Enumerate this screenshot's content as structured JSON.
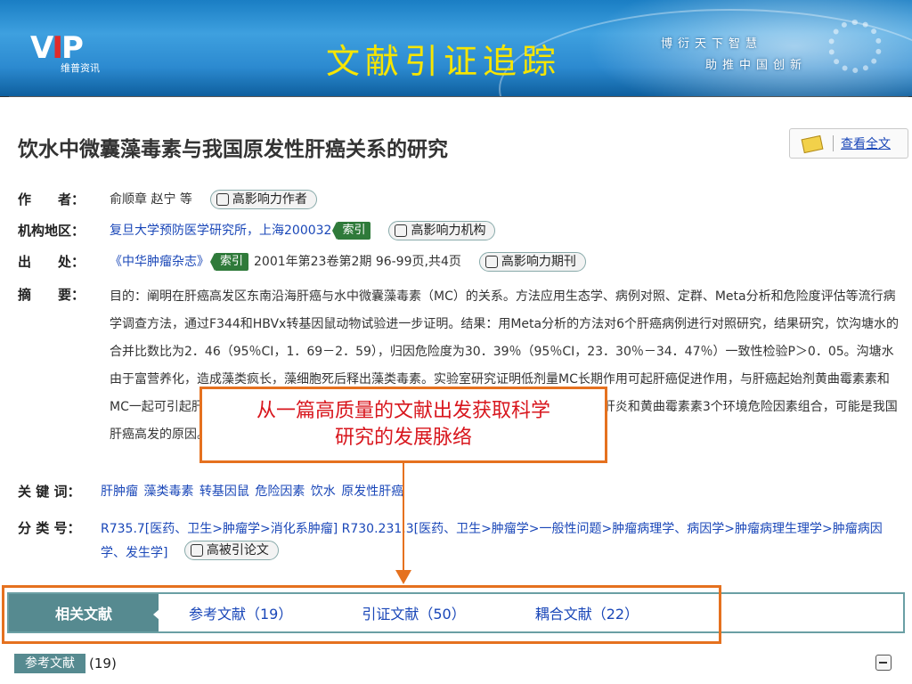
{
  "banner": {
    "logo_text": "VIP",
    "logo_sub": "维普资讯",
    "title": "文献引证追踪",
    "slogan_line1": "博衍天下智慧",
    "slogan_line2": "助推中国创新"
  },
  "article": {
    "title": "饮水中微囊藻毒素与我国原发性肝癌关系的研究",
    "fulltext_label": "查看全文",
    "author_label": "作　　者：",
    "authors": "俞顺章 赵宁 等",
    "author_pill": "高影响力作者",
    "org_label": "机构地区：",
    "org": "复旦大学预防医学研究所，上海200032",
    "org_index": "索引",
    "org_pill": "高影响力机构",
    "source_label": "出　　处：",
    "source_journal": "《中华肿瘤杂志》",
    "source_index": "索引",
    "source_detail": "2001年第23卷第2期 96-99页,共4页",
    "source_pill": "高影响力期刊",
    "abstract_label": "摘　　要：",
    "abstract": "目的：阐明在肝癌高发区东南沿海肝癌与水中微囊藻毒素（MC）的关系。方法应用生态学、病例对照、定群、Meta分析和危险度评估等流行病学调查方法，通过F344和HBVx转基因鼠动物试验进一步证明。结果：用Meta分析的方法对6个肝癌病例进行对照研究，结果研究，饮沟塘水的合并比数比为2．46（95％CI，1．69－2．59），归因危险度为30．39％（95％CI，23．30％－34．47％）一致性检验P＞0．05。沟塘水由于富营养化，造成藻类疯长，藻细胞死后释出藻类毒素。实验室研究证明低剂量MC长期作用可起肝癌促进作用，与肝癌起始剂黄曲霉素素和MC一起可引起肝细胞肝癌。结论沟塘水中藻类毒素是我国东南沿海地区肝癌发生的与乙型肝炎和黄曲霉素素3个环境危险因素组合，可能是我国肝癌高发的原因。",
    "keywords_label": "关 键 词：",
    "keywords": "肝肿瘤 藻类毒素 转基因鼠 危险因素 饮水 原发性肝癌",
    "class_label": "分 类 号：",
    "classification": "R735.7[医药、卫生>肿瘤学>消化系肿瘤] R730.231.3[医药、卫生>肿瘤学>一般性问题>肿瘤病理学、病因学>肿瘤病理生理学>肿瘤病因学、发生学]",
    "class_pill": "高被引论文"
  },
  "callout": {
    "line1": "从一篇高质量的文献出发获取科学",
    "line2": "研究的发展脉络"
  },
  "tabs": [
    {
      "label": "相关文献"
    },
    {
      "label": "参考文献（19）"
    },
    {
      "label": "引证文献（50）"
    },
    {
      "label": "耦合文献（22）"
    }
  ],
  "ref_section": {
    "tag": "参考文献",
    "count": "(19)"
  }
}
